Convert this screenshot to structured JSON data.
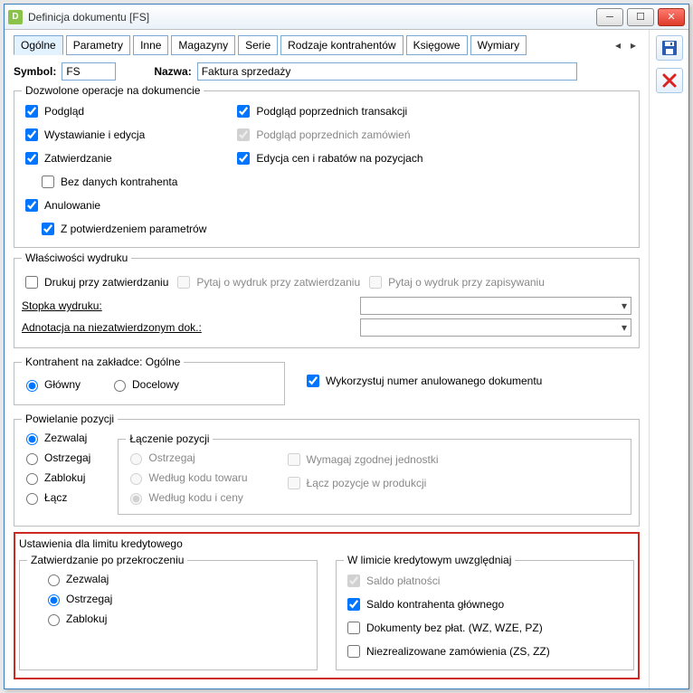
{
  "window": {
    "title": "Definicja dokumentu [FS]"
  },
  "tabs": {
    "items": [
      "Ogólne",
      "Parametry",
      "Inne",
      "Magazyny",
      "Serie",
      "Rodzaje kontrahentów",
      "Księgowe",
      "Wymiary"
    ],
    "arrow_left": "◂",
    "arrow_right": "▸"
  },
  "fields": {
    "symbol_label": "Symbol:",
    "symbol_value": "FS",
    "name_label": "Nazwa:",
    "name_value": "Faktura sprzedaży"
  },
  "allowed_ops": {
    "legend": "Dozwolone operacje na dokumencie",
    "preview": "Podgląd",
    "issue_edit": "Wystawianie i edycja",
    "confirm": "Zatwierdzanie",
    "no_contractor": "Bez danych kontrahenta",
    "cancel": "Anulowanie",
    "with_confirm_params": "Z potwierdzeniem parametrów",
    "prev_trans": "Podgląd poprzednich transakcji",
    "prev_orders": "Podgląd poprzednich zamówień",
    "edit_prices": "Edycja cen i rabatów na pozycjach"
  },
  "print_props": {
    "legend": "Właściwości wydruku",
    "print_confirm": "Drukuj przy zatwierdzaniu",
    "ask_print_confirm": "Pytaj o wydruk przy zatwierdzaniu",
    "ask_print_save": "Pytaj o wydruk przy zapisywaniu",
    "footer_label": "Stopka wydruku:",
    "annotation_label": "Adnotacja na niezatwierdzonym dok.:"
  },
  "contractor": {
    "legend": "Kontrahent na zakładce: Ogólne",
    "main": "Główny",
    "target": "Docelowy",
    "reuse_canceled": "Wykorzystuj numer anulowanego dokumentu"
  },
  "duplicate": {
    "legend": "Powielanie pozycji",
    "allow": "Zezwalaj",
    "warn": "Ostrzegaj",
    "block": "Zablokuj",
    "merge": "Łącz",
    "merge_legend": "Łączenie pozycji",
    "merge_warn": "Ostrzegaj",
    "by_code": "Według kodu towaru",
    "by_code_price": "Według kodu i ceny",
    "require_unit": "Wymagaj zgodnej jednostki",
    "merge_prod": "Łącz pozycje w produkcji"
  },
  "credit": {
    "legend": "Ustawienia dla limitu kredytowego",
    "confirm_over_legend": "Zatwierdzanie po przekroczeniu",
    "allow": "Zezwalaj",
    "warn": "Ostrzegaj",
    "block": "Zablokuj",
    "include_legend": "W limicie kredytowym uwzględniaj",
    "balance": "Saldo płatności",
    "main_contractor_balance": "Saldo kontrahenta głównego",
    "docs_no_payment": "Dokumenty bez płat. (WZ, WZE, PZ)",
    "unfulfilled": "Niezrealizowane zamówienia (ZS, ZZ)"
  }
}
